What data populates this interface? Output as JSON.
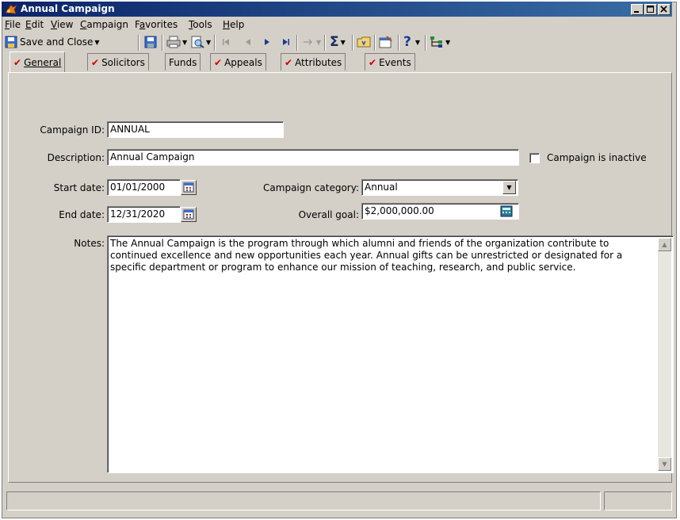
{
  "window": {
    "title": "Annual Campaign"
  },
  "menu": [
    {
      "label": "File",
      "key": "F",
      "rest": "ile"
    },
    {
      "label": "Edit",
      "key": "E",
      "rest": "dit"
    },
    {
      "label": "View",
      "key": "V",
      "rest": "iew"
    },
    {
      "label": "Campaign",
      "key": "C",
      "rest": "ampaign"
    },
    {
      "label": "Favorites",
      "key": "a",
      "pre": "F",
      "rest": "vorites"
    },
    {
      "label": "Tools",
      "key": "T",
      "rest": "ools"
    },
    {
      "label": "Help",
      "key": "H",
      "rest": "elp"
    }
  ],
  "toolbar": {
    "save_close_label": "Save and Close",
    "icons": [
      "save-icon",
      "print-icon",
      "print-preview-icon",
      "first-record-icon",
      "previous-record-icon",
      "next-record-icon",
      "last-record-icon",
      "go-to-icon",
      "sum-icon",
      "folder-icon",
      "properties-icon",
      "help-icon",
      "tree-icon"
    ]
  },
  "tabs": [
    {
      "label": "General",
      "checked": true,
      "active": true
    },
    {
      "label": "Solicitors",
      "checked": true
    },
    {
      "label": "Funds",
      "checked": false
    },
    {
      "label": "Appeals",
      "checked": true
    },
    {
      "label": "Attributes",
      "checked": true
    },
    {
      "label": "Events",
      "checked": true
    }
  ],
  "form": {
    "campaign_id_label": "Campaign ID:",
    "campaign_id_value": "ANNUAL",
    "description_label": "Description:",
    "description_value": "Annual Campaign",
    "inactive_label": "Campaign is inactive",
    "inactive_checked": false,
    "start_date_label": "Start date:",
    "start_date_value": "01/01/2000",
    "end_date_label": "End date:",
    "end_date_value": "12/31/2020",
    "category_label": "Campaign category:",
    "category_value": "Annual",
    "goal_label": "Overall goal:",
    "goal_value": "$2,000,000.00",
    "notes_label": "Notes:",
    "notes_value": "The Annual Campaign is the program through which alumni and friends of the organization contribute to continued excellence and new opportunities each year. Annual gifts can be unrestricted or designated for a specific department or program to enhance our mission of teaching, research, and public service."
  },
  "colors": {
    "titlebar_start": "#0a246a",
    "titlebar_end": "#3a6ea5",
    "face": "#d4d0c8",
    "check": "#cc0000"
  }
}
